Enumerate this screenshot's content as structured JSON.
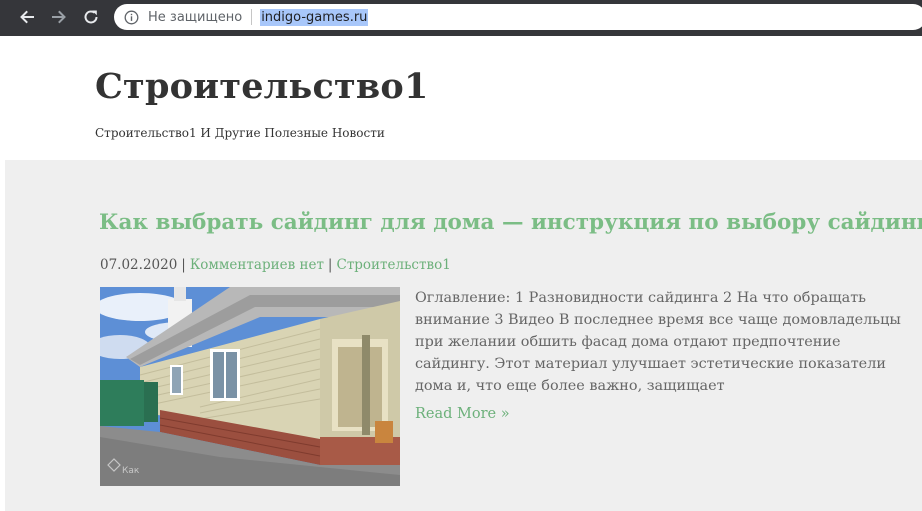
{
  "browser": {
    "security_label": "Не защищено",
    "url": "indigo-games.ru",
    "icons": {
      "back": "arrow-left-icon",
      "forward": "arrow-right-icon",
      "reload": "reload-icon",
      "info": "info-icon"
    }
  },
  "site": {
    "title": "Строительство1",
    "tagline": "Строительство1 И Другие Полезные Новости"
  },
  "post": {
    "title": "Как выбрать сайдинг для дома — инструкция по выбору сайдинга",
    "date": "07.02.2020",
    "separator": "|",
    "comments": "Комментариев нет",
    "category": "Строительство1",
    "excerpt": "Оглавление: 1 Разновидности сайдинга 2 На что обращать внимание 3 Видео В последнее время все чаще домовладельцы при желании обшить фасад дома отдают предпочтение сайдингу. Этот материал улучшает эстетические показатели дома и, что еще более важно, защищает",
    "read_more": "Read More »",
    "thumbnail_watermark": "Как"
  },
  "colors": {
    "chrome": "#35363a",
    "accent_green": "#7bbd85",
    "content_bg": "#efefef",
    "url_highlight": "#a8c7fa"
  }
}
